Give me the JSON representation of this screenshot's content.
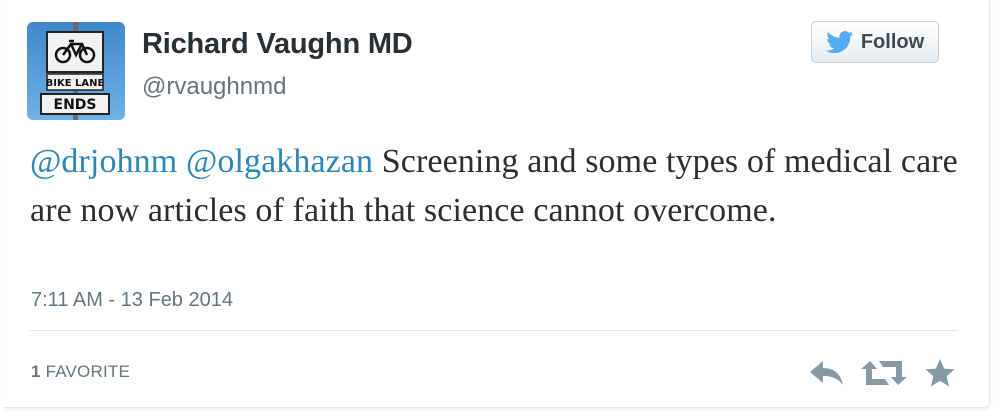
{
  "user": {
    "name": "Richard Vaughn MD",
    "handle": "@rvaughnmd",
    "avatar": {
      "icon": "bike-lane-ends-sign",
      "sign_top": "BIKE LANE",
      "sign_bottom": "ENDS"
    }
  },
  "follow_button": {
    "label": "Follow",
    "icon": "twitter-bird-icon"
  },
  "tweet": {
    "mentions": [
      "@drjohnm",
      "@olgakhazan"
    ],
    "text": " Screening and some types of medical care are now articles of faith that science cannot overcome.",
    "timestamp": "7:11 AM - 13 Feb 2014"
  },
  "stats": {
    "favorite_count": "1",
    "favorite_label": "FAVORITE"
  },
  "actions": {
    "reply_icon": "reply-icon",
    "retweet_icon": "retweet-icon",
    "favorite_icon": "star-icon"
  },
  "colors": {
    "link": "#2b87b8",
    "text": "#292f33",
    "muted": "#66757f",
    "twitter_blue": "#55acee",
    "action_gray": "#8899a6"
  }
}
